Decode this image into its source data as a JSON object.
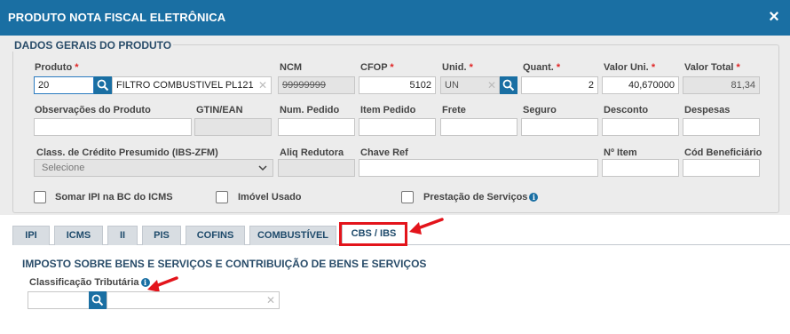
{
  "window": {
    "title": "PRODUTO NOTA FISCAL ELETRÔNICA",
    "close_icon": "×"
  },
  "general": {
    "legend": "DADOS GERAIS DO PRODUTO",
    "produto": {
      "label": "Produto",
      "code": "20",
      "description": "FILTRO COMBUSTIVEL PL121"
    },
    "ncm": {
      "label": "NCM",
      "value": "99999999"
    },
    "cfop": {
      "label": "CFOP",
      "value": "5102"
    },
    "unid": {
      "label": "Unid.",
      "value": "UN"
    },
    "quant": {
      "label": "Quant.",
      "value": "2"
    },
    "valor_uni": {
      "label": "Valor Uni.",
      "value": "40,670000"
    },
    "valor_total": {
      "label": "Valor Total",
      "value": "81,34"
    },
    "required_mark": "*",
    "observacoes": {
      "label": "Observações do Produto",
      "value": ""
    },
    "gtin": {
      "label": "GTIN/EAN",
      "value": ""
    },
    "num_pedido": {
      "label": "Num. Pedido",
      "value": ""
    },
    "item_pedido": {
      "label": "Item Pedido",
      "value": ""
    },
    "frete": {
      "label": "Frete",
      "value": ""
    },
    "seguro": {
      "label": "Seguro",
      "value": ""
    },
    "desconto": {
      "label": "Desconto",
      "value": ""
    },
    "despesas": {
      "label": "Despesas",
      "value": ""
    },
    "class_credito": {
      "label": "Class. de Crédito Presumido (IBS-ZFM)",
      "selected": "Selecione"
    },
    "aliq_redutora": {
      "label": "Aliq Redutora",
      "value": ""
    },
    "chave_ref": {
      "label": "Chave Ref",
      "value": ""
    },
    "n_item": {
      "label": "Nº Item",
      "value": ""
    },
    "cod_beneficiario": {
      "label": "Cód Beneficiário",
      "value": ""
    },
    "checkboxes": {
      "somar_ipi": "Somar IPI na BC do ICMS",
      "imovel_usado": "Imóvel Usado",
      "prestacao_servicos": "Prestação de Serviços"
    },
    "info_glyph": "i"
  },
  "tabs": [
    {
      "label": "IPI"
    },
    {
      "label": "ICMS"
    },
    {
      "label": "II"
    },
    {
      "label": "PIS"
    },
    {
      "label": "COFINS"
    },
    {
      "label": "COMBUSTÍVEL"
    },
    {
      "label": "CBS / IBS"
    }
  ],
  "active_tab": "CBS / IBS",
  "cbs_ibs": {
    "section_title": "IMPOSTO SOBRE BENS E SERVIÇOS E CONTRIBUIÇÃO DE BENS E SERVIÇOS",
    "classificacao_label": "Classificação Tributária",
    "classificacao_code": "",
    "classificacao_desc": ""
  },
  "colors": {
    "header": "#1a6fa3",
    "accent_red": "#e3141b",
    "required": "#e02424"
  }
}
